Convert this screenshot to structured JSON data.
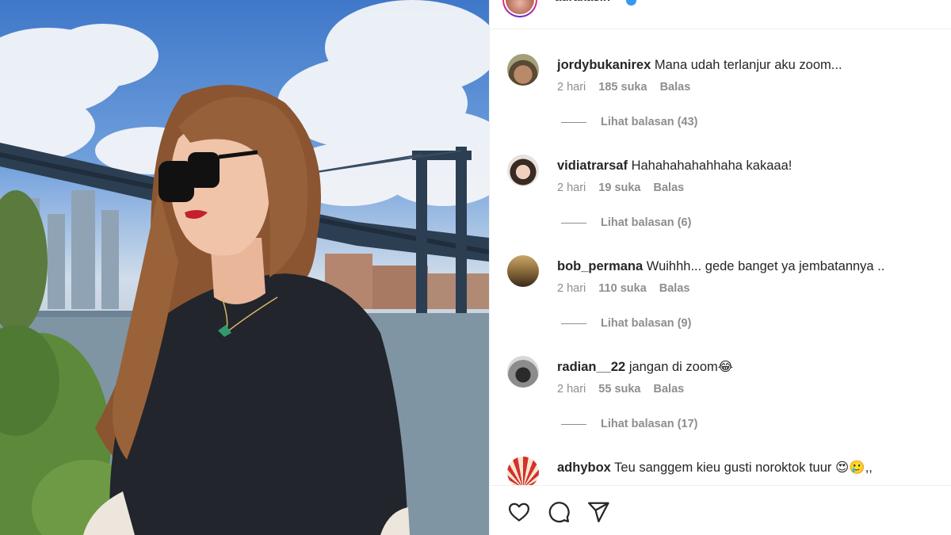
{
  "post": {
    "username": "aurakasih",
    "verified": true
  },
  "comments": [
    {
      "username": "jordybukanirex",
      "text": "Mana udah terlanjur aku zoom...",
      "time": "2 hari",
      "likes": "185 suka",
      "reply": "Balas",
      "view_replies": "Lihat balasan (43)"
    },
    {
      "username": "vidiatrarsaf",
      "text": "Hahahahahahhaha kakaaa!",
      "time": "2 hari",
      "likes": "19 suka",
      "reply": "Balas",
      "view_replies": "Lihat balasan (6)"
    },
    {
      "username": "bob_permana",
      "text": "Wuihhh... gede banget ya jembatannya ..",
      "time": "2 hari",
      "likes": "110 suka",
      "reply": "Balas",
      "view_replies": "Lihat balasan (9)"
    },
    {
      "username": "radian__22",
      "text": "jangan di zoom😂",
      "time": "2 hari",
      "likes": "55 suka",
      "reply": "Balas",
      "view_replies": "Lihat balasan (17)"
    },
    {
      "username": "adhybox",
      "text": "Teu sanggem kieu gusti noroktok tuur 😍🥲,,",
      "time": "",
      "likes": "",
      "reply": "",
      "view_replies": ""
    }
  ],
  "actions": {
    "like_icon": "heart-icon",
    "comment_icon": "comment-icon",
    "share_icon": "send-icon"
  },
  "colors": {
    "text": "#262626",
    "muted": "#8e8e8e",
    "verified": "#3897f0",
    "border": "#efefef"
  }
}
